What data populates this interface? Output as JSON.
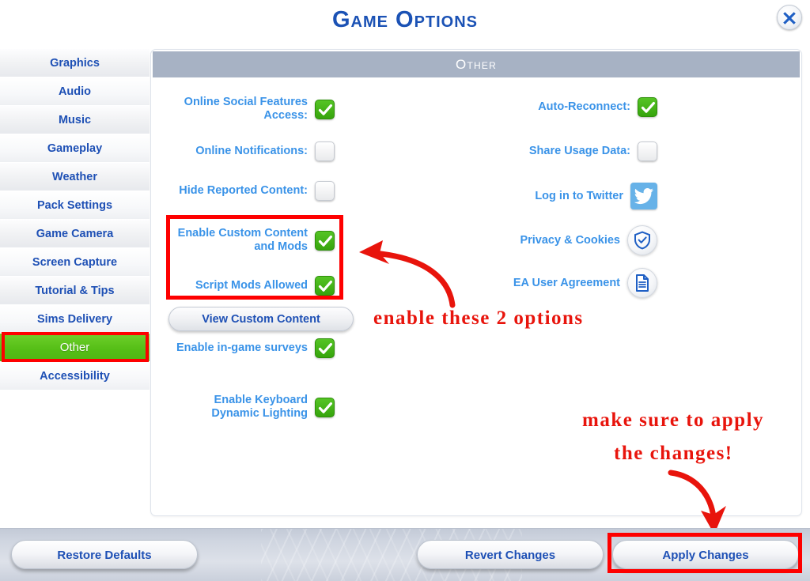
{
  "window": {
    "title": "Game Options",
    "close_icon": "close-icon"
  },
  "sidebar": {
    "items": [
      {
        "label": "Graphics",
        "active": false
      },
      {
        "label": "Audio",
        "active": false
      },
      {
        "label": "Music",
        "active": false
      },
      {
        "label": "Gameplay",
        "active": false
      },
      {
        "label": "Weather",
        "active": false
      },
      {
        "label": "Pack Settings",
        "active": false
      },
      {
        "label": "Game Camera",
        "active": false
      },
      {
        "label": "Screen Capture",
        "active": false
      },
      {
        "label": "Tutorial & Tips",
        "active": false
      },
      {
        "label": "Sims Delivery",
        "active": false
      },
      {
        "label": "Other",
        "active": true
      },
      {
        "label": "Accessibility",
        "active": false
      }
    ],
    "active_label": "Other"
  },
  "content": {
    "section_header": "Other",
    "left_column": [
      {
        "label": "Online Social Features Access:",
        "control": "checkbox",
        "checked": true,
        "name": "online-social-features-access"
      },
      {
        "label": "Online Notifications:",
        "control": "checkbox",
        "checked": false,
        "name": "online-notifications"
      },
      {
        "label": "Hide Reported Content:",
        "control": "checkbox",
        "checked": false,
        "name": "hide-reported-content"
      },
      {
        "label": "Enable Custom Content and Mods",
        "control": "checkbox",
        "checked": true,
        "name": "enable-custom-content-and-mods"
      },
      {
        "label": "Script Mods Allowed",
        "control": "checkbox",
        "checked": true,
        "name": "script-mods-allowed"
      },
      {
        "label": "Enable in-game surveys",
        "control": "checkbox",
        "checked": true,
        "name": "enable-in-game-surveys"
      },
      {
        "label": "Enable Keyboard Dynamic Lighting",
        "control": "checkbox",
        "checked": true,
        "name": "enable-keyboard-dynamic-lighting"
      }
    ],
    "view_custom_content_button": "View Custom Content",
    "right_column": [
      {
        "label": "Auto-Reconnect:",
        "control": "checkbox",
        "checked": true,
        "name": "auto-reconnect"
      },
      {
        "label": "Share Usage Data:",
        "control": "checkbox",
        "checked": false,
        "name": "share-usage-data"
      },
      {
        "label": "Log in to Twitter",
        "control": "icon",
        "icon": "twitter-icon",
        "name": "log-in-to-twitter"
      },
      {
        "label": "Privacy & Cookies",
        "control": "icon",
        "icon": "shield-check-icon",
        "name": "privacy-and-cookies"
      },
      {
        "label": "EA User Agreement",
        "control": "icon",
        "icon": "document-icon",
        "name": "ea-user-agreement"
      }
    ]
  },
  "footer": {
    "restore_defaults": "Restore Defaults",
    "revert_changes": "Revert Changes",
    "apply_changes": "Apply Changes"
  },
  "annotations": {
    "enable_options": "enable these 2 options",
    "apply_line1": "make sure to apply",
    "apply_line2": "the changes!",
    "highlight_color": "#fe0000",
    "annotation_color": "#e8140c"
  },
  "colors": {
    "title_blue": "#1b52b5",
    "label_blue": "#3a93e8",
    "active_green": "#56bf17",
    "section_header_bg": "#a7b2c4",
    "checkbox_on": "#36a40c",
    "twitter_blue": "#67b2e8"
  }
}
